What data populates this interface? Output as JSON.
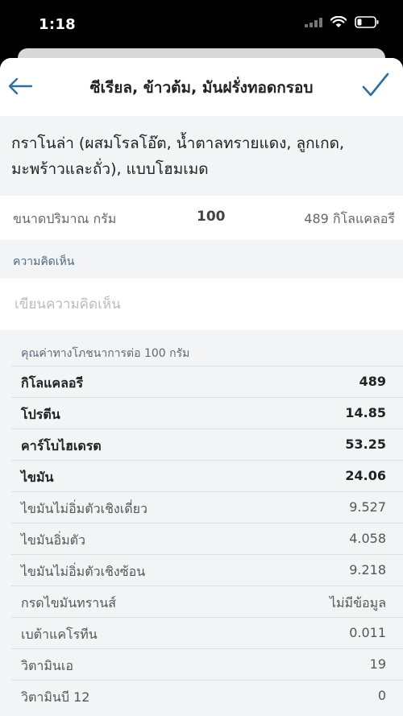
{
  "status": {
    "time": "1:18"
  },
  "nav": {
    "title": "ซีเรียล, ข้าวต้ม, มันฝรั่งทอดกรอบ",
    "back_icon": "back-arrow-icon",
    "confirm_icon": "checkmark-icon",
    "accent": "#2f6f9e"
  },
  "food": {
    "name": "กราโนล่า (ผสมโรลโอ๊ต, น้ำตาลทรายแดง, ลูกเกด, มะพร้าวและถั่ว), แบบโฮมเมด"
  },
  "serving": {
    "label": "ขนาดปริมาณ กรัม",
    "value": "100",
    "calories": "489 กิโลแคลอรี"
  },
  "comment": {
    "header": "ความคิดเห็น",
    "placeholder": "เขียนความคิดเห็น",
    "value": ""
  },
  "nutrition": {
    "header": "คุณค่าทางโภชนาการต่อ 100 กรัม",
    "rows": [
      {
        "label": "กิโลแคลอรี",
        "value": "489"
      },
      {
        "label": "โปรตีน",
        "value": "14.85"
      },
      {
        "label": "คาร์โบไฮเดรต",
        "value": "53.25"
      },
      {
        "label": "ไขมัน",
        "value": "24.06"
      },
      {
        "label": "ไขมันไม่อิ่มตัวเชิงเดี่ยว",
        "value": "9.527"
      },
      {
        "label": "ไขมันอิ่มตัว",
        "value": "4.058"
      },
      {
        "label": "ไขมันไม่อิ่มตัวเชิงซ้อน",
        "value": "9.218"
      },
      {
        "label": "กรดไขมันทรานส์",
        "value": "ไม่มีข้อมูล"
      },
      {
        "label": "เบต้าแคโรทีน",
        "value": "0.011"
      },
      {
        "label": "วิตามินเอ",
        "value": "19"
      },
      {
        "label": "วิตามินบี 12",
        "value": "0"
      }
    ]
  }
}
